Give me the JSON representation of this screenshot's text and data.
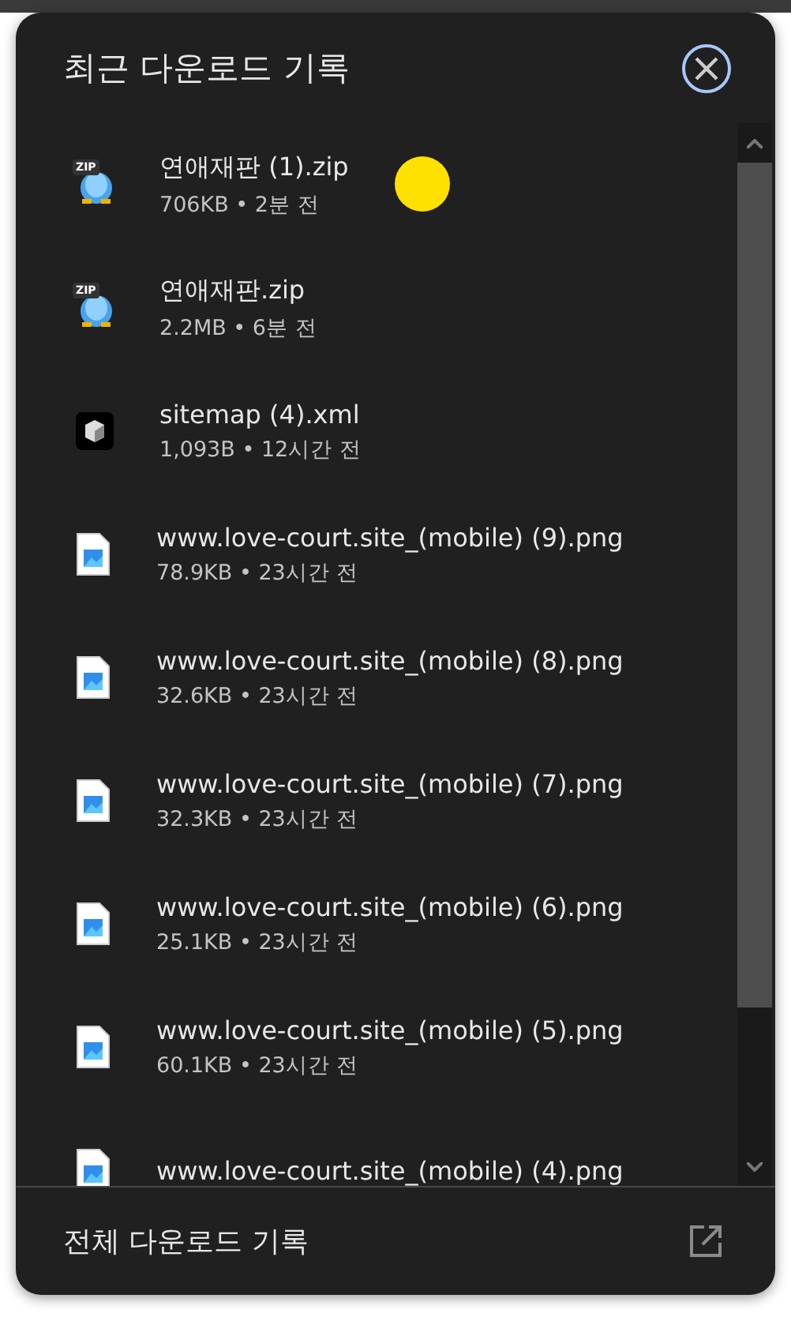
{
  "panel": {
    "title": "최근 다운로드 기록"
  },
  "downloads": [
    {
      "kind": "zip",
      "badge": "ZIP",
      "name": "연애재판 (1).zip",
      "meta": "706KB • 2분 전"
    },
    {
      "kind": "zip",
      "badge": "ZIP",
      "name": "연애재판.zip",
      "meta": "2.2MB • 6분 전"
    },
    {
      "kind": "xml",
      "name": "sitemap (4).xml",
      "meta": "1,093B • 12시간 전"
    },
    {
      "kind": "image",
      "name": "www.love-court.site_(mobile) (9).png",
      "meta": "78.9KB • 23시간 전"
    },
    {
      "kind": "image",
      "name": "www.love-court.site_(mobile) (8).png",
      "meta": "32.6KB • 23시간 전"
    },
    {
      "kind": "image",
      "name": "www.love-court.site_(mobile) (7).png",
      "meta": "32.3KB • 23시간 전"
    },
    {
      "kind": "image",
      "name": "www.love-court.site_(mobile) (6).png",
      "meta": "25.1KB • 23시간 전"
    },
    {
      "kind": "image",
      "name": "www.love-court.site_(mobile) (5).png",
      "meta": "60.1KB • 23시간 전"
    },
    {
      "kind": "image",
      "name": "www.love-court.site_(mobile) (4).png"
    }
  ],
  "footer": {
    "label": "전체 다운로드 기록"
  }
}
